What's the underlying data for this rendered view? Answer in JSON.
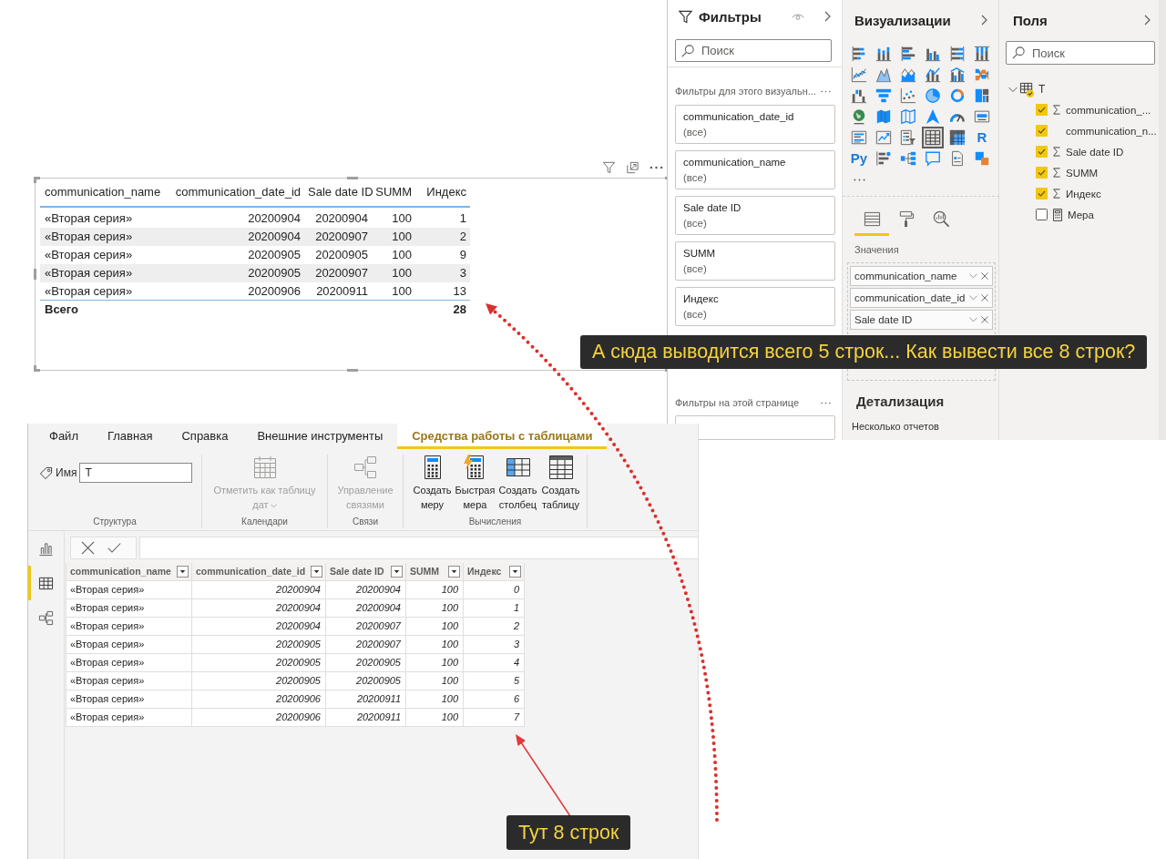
{
  "visual": {
    "table": {
      "columns": [
        "communication_name",
        "communication_date_id",
        "Sale date ID",
        "SUMM",
        "Индекс"
      ],
      "rows": [
        [
          "«Вторая серия»",
          "20200904",
          "20200904",
          "100",
          "1"
        ],
        [
          "«Вторая серия»",
          "20200904",
          "20200907",
          "100",
          "2"
        ],
        [
          "«Вторая серия»",
          "20200905",
          "20200905",
          "100",
          "9"
        ],
        [
          "«Вторая серия»",
          "20200905",
          "20200907",
          "100",
          "3"
        ],
        [
          "«Вторая серия»",
          "20200906",
          "20200911",
          "100",
          "13"
        ]
      ],
      "total": {
        "label": "Всего",
        "value": "28"
      }
    }
  },
  "filters_pane": {
    "title": "Фильтры",
    "search": {
      "placeholder": "Поиск"
    },
    "visual_filters": {
      "title": "Фильтры для этого визуальн...",
      "cards": [
        {
          "field": "communication_date_id",
          "value": "(все)"
        },
        {
          "field": "communication_name",
          "value": "(все)"
        },
        {
          "field": "Sale date ID",
          "value": "(все)"
        },
        {
          "field": "SUMM",
          "value": "(все)"
        },
        {
          "field": "Индекс",
          "value": "(все)"
        }
      ]
    },
    "page_filters": {
      "title": "Фильтры на этой странице"
    }
  },
  "visualizations_pane": {
    "title": "Визуализации",
    "gallery": [
      {
        "selected": false
      },
      {
        "selected": false
      },
      {
        "selected": false
      },
      {
        "selected": false
      },
      {
        "selected": false
      },
      {
        "selected": false
      },
      {
        "selected": false
      },
      {
        "selected": false
      },
      {
        "selected": false
      },
      {
        "selected": false
      },
      {
        "selected": false
      },
      {
        "selected": false
      },
      {
        "selected": false
      },
      {
        "selected": false
      },
      {
        "selected": false
      },
      {
        "selected": false
      },
      {
        "selected": false
      },
      {
        "selected": false
      },
      {
        "selected": false
      },
      {
        "selected": false
      },
      {
        "selected": false
      },
      {
        "selected": false
      },
      {
        "selected": false
      },
      {
        "selected": false
      },
      {
        "selected": false
      },
      {
        "selected": false
      },
      {
        "selected": false
      },
      {
        "selected": true
      },
      {
        "selected": false
      },
      {
        "label": "R",
        "selected": false
      },
      {
        "label": "Py",
        "selected": false
      },
      {
        "selected": false
      },
      {
        "selected": false
      },
      {
        "selected": false
      },
      {
        "selected": false
      },
      {
        "selected": false
      }
    ],
    "build_tabs": [
      {
        "selected": true
      },
      {
        "selected": false
      },
      {
        "selected": false
      }
    ],
    "wells_label": "Значения",
    "wells": [
      "communication_name",
      "communication_date_id",
      "Sale date ID"
    ],
    "drillthrough": {
      "title": "Детализация",
      "label": "Несколько отчетов"
    }
  },
  "fields_pane": {
    "title": "Поля",
    "search": {
      "placeholder": "Поиск"
    },
    "table": {
      "name": "T",
      "expanded": true,
      "children": [
        {
          "name": "communication_...",
          "kind": "sum",
          "checked": true
        },
        {
          "name": "communication_n...",
          "kind": "column",
          "checked": true
        },
        {
          "name": "Sale date ID",
          "kind": "sum",
          "checked": true
        },
        {
          "name": "SUMM",
          "kind": "sum",
          "checked": true
        },
        {
          "name": "Индекс",
          "kind": "sum",
          "checked": true
        },
        {
          "name": "Мера",
          "kind": "measure",
          "checked": false
        }
      ]
    }
  },
  "desktop": {
    "ribbon": {
      "tabs": [
        {
          "label": "Файл",
          "selected": false
        },
        {
          "label": "Главная",
          "selected": false
        },
        {
          "label": "Справка",
          "selected": false
        },
        {
          "label": "Внешние инструменты",
          "selected": false
        },
        {
          "label": "Средства работы с таблицами",
          "selected": true
        }
      ],
      "groups": [
        {
          "label": "Структура",
          "name_field": {
            "label": "Имя",
            "value": "T"
          }
        },
        {
          "label": "Календари",
          "buttons": [
            {
              "label": "Отметить как таблицу дат",
              "disabled": true,
              "dropdown": true
            }
          ]
        },
        {
          "label": "Связи",
          "buttons": [
            {
              "label": "Управление связями",
              "disabled": true,
              "dropdown": false
            }
          ]
        },
        {
          "label": "Вычисления",
          "buttons": [
            {
              "label": "Создать меру",
              "disabled": false,
              "dropdown": false
            },
            {
              "label": "Быстрая мера",
              "disabled": false,
              "dropdown": false
            },
            {
              "label": "Создать столбец",
              "disabled": false,
              "dropdown": false
            },
            {
              "label": "Создать таблицу",
              "disabled": false,
              "dropdown": false
            }
          ]
        }
      ]
    },
    "views": [
      {
        "selected": false
      },
      {
        "selected": true
      },
      {
        "selected": false
      }
    ],
    "grid": {
      "columns": [
        "communication_name",
        "communication_date_id",
        "Sale date ID",
        "SUMM",
        "Индекс"
      ],
      "rows": [
        [
          "«Вторая серия»",
          "20200904",
          "20200904",
          "100",
          "0"
        ],
        [
          "«Вторая серия»",
          "20200904",
          "20200904",
          "100",
          "1"
        ],
        [
          "«Вторая серия»",
          "20200904",
          "20200907",
          "100",
          "2"
        ],
        [
          "«Вторая серия»",
          "20200905",
          "20200907",
          "100",
          "3"
        ],
        [
          "«Вторая серия»",
          "20200905",
          "20200905",
          "100",
          "4"
        ],
        [
          "«Вторая серия»",
          "20200905",
          "20200905",
          "100",
          "5"
        ],
        [
          "«Вторая серия»",
          "20200906",
          "20200911",
          "100",
          "6"
        ],
        [
          "«Вторая серия»",
          "20200906",
          "20200911",
          "100",
          "7"
        ]
      ]
    }
  },
  "annotations": [
    {
      "kind": "callout",
      "text": "А сюда выводится всего 5 строк... Как вывести все 8 строк?"
    },
    {
      "kind": "callout",
      "text": "Тут 8 строк"
    }
  ]
}
